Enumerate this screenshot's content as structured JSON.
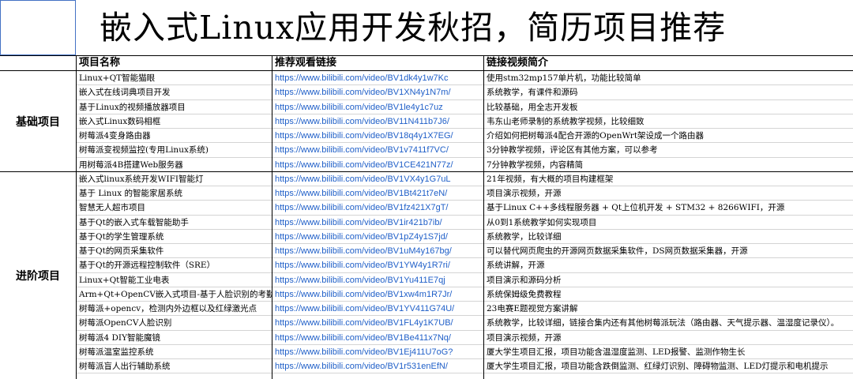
{
  "title": "嵌入式Linux应用开发秋招，简历项目推荐",
  "headers": {
    "name": "项目名称",
    "link": "推荐观看链接",
    "desc": "链接视频简介"
  },
  "categories": [
    "基础项目",
    "进阶项目"
  ],
  "rows": [
    {
      "cat": 0,
      "name": "Linux+QT智能猫眼",
      "link": "https://www.bilibili.com/video/BV1dk4y1w7Kc",
      "desc": "使用stm32mp157单片机，功能比较简单"
    },
    {
      "cat": 0,
      "name": "嵌入式在线词典项目开发",
      "link": "https://www.bilibili.com/video/BV1XN4y1N7m/",
      "desc": "系统教学，有课件和源码"
    },
    {
      "cat": 0,
      "name": "基于Linux的视频播放器项目",
      "link": "https://www.bilibili.com/video/BV1le4y1c7uz",
      "desc": "比较基础，用全志开发板"
    },
    {
      "cat": 0,
      "name": "嵌入式Linux数码相框",
      "link": "https://www.bilibili.com/video/BV11N411b7J6/",
      "desc": "韦东山老师录制的系统教学视频，比较细致"
    },
    {
      "cat": 0,
      "name": "树莓派4变身路由器",
      "link": "https://www.bilibili.com/video/BV18q4y1X7EG/",
      "desc": "介绍如何把树莓派4配合开源的OpenWrt架设成一个路由器"
    },
    {
      "cat": 0,
      "name": "树莓派变视频监控(专用Linux系统)",
      "link": "https://www.bilibili.com/video/BV1v7411f7VC/",
      "desc": "3分钟教学视频，评论区有其他方案，可以参考"
    },
    {
      "cat": 0,
      "name": "用树莓派4B搭建Web服务器",
      "link": "https://www.bilibili.com/video/BV1CE421N77z/",
      "desc": "7分钟教学视频，内容精简"
    },
    {
      "cat": 1,
      "name": "嵌入式linux系统开发WIFI智能灯",
      "link": "https://www.bilibili.com/video/BV1VX4y1G7uL",
      "desc": "21年视频，有大概的项目构建框架"
    },
    {
      "cat": 1,
      "name": "基于 Linux 的智能家居系统",
      "link": "https://www.bilibili.com/video/BV1Bt421t7eN/",
      "desc": "项目演示视频，开源"
    },
    {
      "cat": 1,
      "name": "智慧无人超市项目",
      "link": "https://www.bilibili.com/video/BV1fz421X7gT/",
      "desc": "基于Linux C++多线程服务器 + Qt上位机开发 + STM32 + 8266WIFI，开源"
    },
    {
      "cat": 1,
      "name": "基于Qt的嵌入式车载智能助手",
      "link": "https://www.bilibili.com/video/BV1ir421b7ib/",
      "desc": "从0到1系统教学如何实现项目"
    },
    {
      "cat": 1,
      "name": "基于Qt的学生管理系统",
      "link": "https://www.bilibili.com/video/BV1pZ4y1S7jd/",
      "desc": "系统教学，比较详细"
    },
    {
      "cat": 1,
      "name": "基于Qt的网页采集软件",
      "link": "https://www.bilibili.com/video/BV1uM4y167bg/",
      "desc": "可以替代网页爬虫的开源网页数据采集软件，DS网页数据采集器，开源"
    },
    {
      "cat": 1,
      "name": "基于Qt的开源远程控制软件（SRE）",
      "link": "https://www.bilibili.com/video/BV1YW4y1R7ri/",
      "desc": "系统讲解，开源"
    },
    {
      "cat": 1,
      "name": "Linux+Qt智能工业电表",
      "link": "https://www.bilibili.com/video/BV1Yu411E7qj",
      "desc": "项目演示和源码分析"
    },
    {
      "cat": 1,
      "name": "Arm+Qt+OpenCV嵌入式项目-基于人脸识别的考勤系统",
      "link": "https://www.bilibili.com/video/BV1xw4m1R7Jr/",
      "desc": "系统保姆级免费教程"
    },
    {
      "cat": 1,
      "name": "树莓派+opencv，检测内外边框以及红绿激光点",
      "link": "https://www.bilibili.com/video/BV1YV411G74U/",
      "desc": "23电赛E题视觉方案讲解"
    },
    {
      "cat": 1,
      "name": "树莓派OpenCV人脸识别",
      "link": "https://www.bilibili.com/video/BV1FL4y1K7UB/",
      "desc": "系统教学，比较详细，链接合集内还有其他树莓派玩法（路由器、天气提示器、温湿度记录仪）。"
    },
    {
      "cat": 1,
      "name": "树莓派4 DIY智能魔镜",
      "link": "https://www.bilibili.com/video/BV1Be411x7Nq/",
      "desc": "项目演示视频，开源"
    },
    {
      "cat": 1,
      "name": "树莓派温室监控系统",
      "link": "https://www.bilibili.com/video/BV1Ej411U7oG?",
      "desc": "厦大学生项目汇报，项目功能含温湿度监测、LED报警、监测作物生长"
    },
    {
      "cat": 1,
      "name": "树莓派盲人出行辅助系统",
      "link": "https://www.bilibili.com/video/BV1r531enEfN/",
      "desc": "厦大学生项目汇报，项目功能含跌倒监测、红绿灯识别、障碍物监测、LED灯提示和电机提示"
    }
  ]
}
